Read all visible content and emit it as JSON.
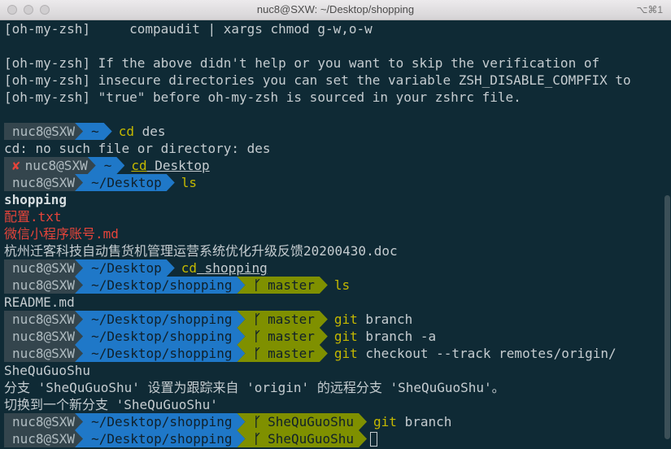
{
  "window": {
    "title": "nuc8@SXW: ~/Desktop/shopping",
    "shortcut": "⌥⌘1"
  },
  "lines": {
    "l1": "[oh-my-zsh]     compaudit | xargs chmod g-w,o-w",
    "l3": "[oh-my-zsh] If the above didn't help or you want to skip the verification of",
    "l4": "[oh-my-zsh] insecure directories you can set the variable ZSH_DISABLE_COMPFIX to",
    "l5": "[oh-my-zsh] \"true\" before oh-my-zsh is sourced in your zshrc file.",
    "err": "cd: no such file or directory: des",
    "f1": "shopping",
    "f2": "配置.txt",
    "f3": "微信小程序账号.md",
    "f4": "杭州迁客科技自动售货机管理运营系统优化升级反馈20200430.doc",
    "readme": "README.md",
    "sheq": "SheQuGuoShu",
    "setup": "分支 'SheQuGuoShu' 设置为跟踪来自 'origin' 的远程分支 'SheQuGuoShu'。",
    "switch": "切换到一个新分支 'SheQuGuoShu'"
  },
  "prompt": {
    "user": "nuc8@SXW",
    "fail": "✘",
    "branch_icon": "ᚴ"
  },
  "prompts": [
    {
      "path": "~",
      "branch": "",
      "cmd": "cd",
      "args": "des"
    },
    {
      "path": "~",
      "branch": "",
      "cmd": "cd",
      "args": "Desktop"
    },
    {
      "path": "~/Desktop",
      "branch": "",
      "cmd": "ls",
      "args": ""
    },
    {
      "path": "~/Desktop",
      "branch": "",
      "cmd": "cd",
      "args": "shopping"
    },
    {
      "path": "~/Desktop/shopping",
      "branch": "master",
      "cmd": "ls",
      "args": ""
    },
    {
      "path": "~/Desktop/shopping",
      "branch": "master",
      "cmd": "git",
      "args": "branch"
    },
    {
      "path": "~/Desktop/shopping",
      "branch": "master",
      "cmd": "git",
      "args": "branch -a"
    },
    {
      "path": "~/Desktop/shopping",
      "branch": "master",
      "cmd": "git",
      "args": "checkout --track remotes/origin/"
    },
    {
      "path": "~/Desktop/shopping",
      "branch": "SheQuGuoShu",
      "cmd": "git",
      "args": "branch"
    },
    {
      "path": "~/Desktop/shopping",
      "branch": "SheQuGuoShu",
      "cmd": "",
      "args": ""
    }
  ]
}
